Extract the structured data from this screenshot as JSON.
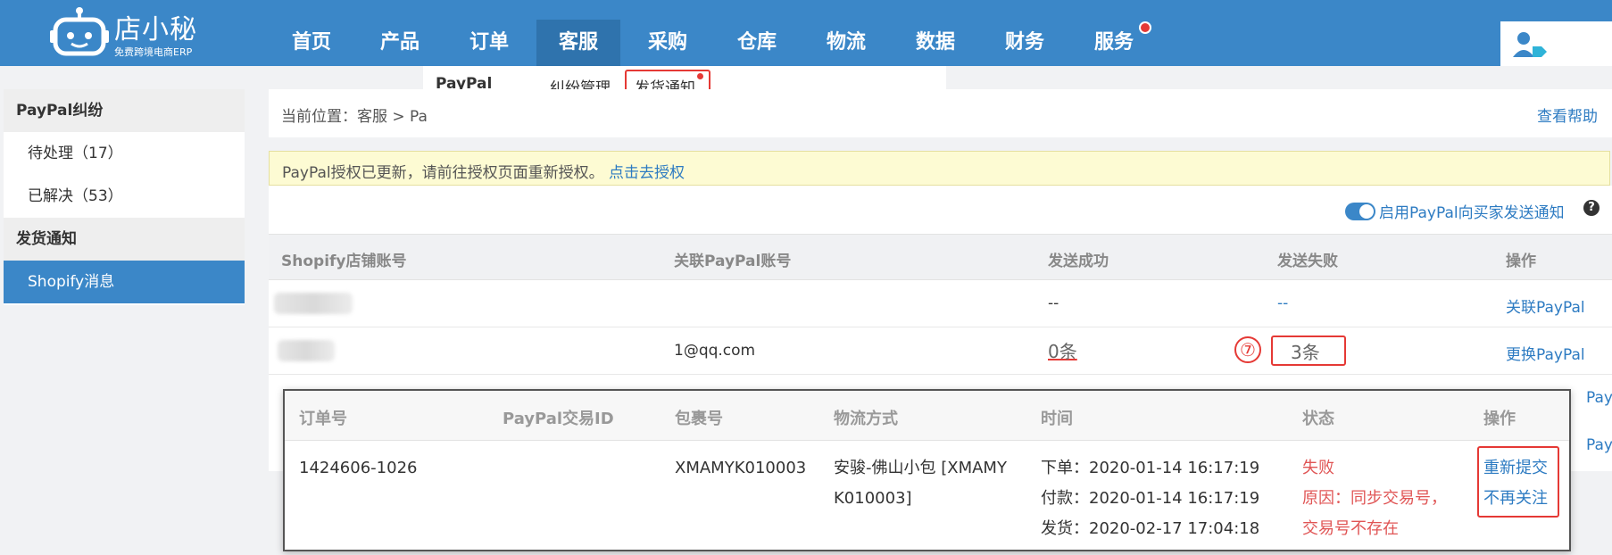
{
  "app": {
    "logo_title": "店小秘",
    "logo_subtitle": "免费跨境电商ERP"
  },
  "nav": {
    "items": [
      {
        "label": "首页",
        "left": 0
      },
      {
        "label": "产品",
        "left": 0
      },
      {
        "label": "订单",
        "left": 0
      },
      {
        "label": "客服",
        "left": 0
      },
      {
        "label": "采购",
        "left": 0
      },
      {
        "label": "仓库",
        "left": 0
      },
      {
        "label": "物流",
        "left": 0
      },
      {
        "label": "数据",
        "left": 0
      },
      {
        "label": "财务",
        "left": 0
      },
      {
        "label": "服务",
        "left": 0
      }
    ],
    "active": "客服"
  },
  "submenu": {
    "items": [
      "PayPal",
      "纠纷管理",
      "发货通知"
    ]
  },
  "sidebar": {
    "group1": "PayPal纠纷",
    "item_pending": "待处理（17）",
    "item_resolved": "已解决（53）",
    "group2": "发货通知",
    "item_shopify": "Shopify消息"
  },
  "breadcrumb": {
    "text": "当前位置：客服 > Pa",
    "help": "查看帮助"
  },
  "notice": {
    "text": "PayPal授权已更新，请前往授权页面重新授权。",
    "link": "点击去授权"
  },
  "toggle": {
    "label": "启用PayPal向买家发送通知",
    "help_icon": "?"
  },
  "table": {
    "headers": [
      "Shopify店铺账号",
      "关联PayPal账号",
      "发送成功",
      "发送失败",
      "操作"
    ],
    "rows": [
      {
        "paypal": "",
        "success": "--",
        "fail": "--",
        "action": "关联PayPal"
      },
      {
        "paypal": "1@qq.com",
        "success": "0条",
        "fail": "3条",
        "action": "更换PayPal"
      }
    ],
    "hidden_action_1": "PayPal",
    "hidden_action_2": "PayPal"
  },
  "annotation": {
    "step": "⑦"
  },
  "popup": {
    "headers": [
      "订单号",
      "PayPal交易ID",
      "包裹号",
      "物流方式",
      "时间",
      "状态",
      "操作"
    ],
    "row": {
      "order_no": "1424606-1026",
      "paypal_txn": "",
      "package_no": "XMAMYK010003",
      "logistics_line1": "安骏-佛山小包 [XMAMY",
      "logistics_line2": "K010003]",
      "time_order": "下单：2020-01-14 16:17:19",
      "time_pay": "付款：2020-01-14 16:17:19",
      "time_ship": "发货：2020-02-17 17:04:18",
      "status": "失败",
      "reason_line1": "原因：同步交易号，",
      "reason_line2": "交易号不存在",
      "action_resubmit": "重新提交",
      "action_ignore": "不再关注"
    }
  },
  "colors": {
    "topbar": "#3b87c8",
    "link": "#2d7bc2",
    "highlight": "#e53935"
  }
}
